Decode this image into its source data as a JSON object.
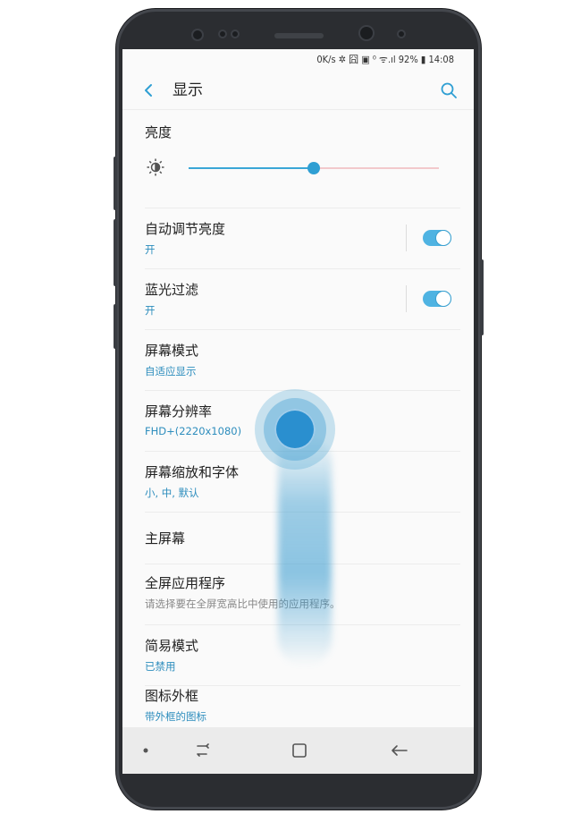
{
  "status_bar": {
    "text": "0K/s ✲ 囧 ▣ ⁰ ᯤ.ıl 92% ▮ 14:08"
  },
  "app_bar": {
    "title": "显示",
    "back_icon": "chevron-left-icon",
    "search_icon": "search-icon"
  },
  "brightness": {
    "title": "亮度",
    "icon": "sun-icon",
    "level": 0.5
  },
  "settings": [
    {
      "title": "自动调节亮度",
      "subtitle": "开",
      "toggle": true
    },
    {
      "title": "蓝光过滤",
      "subtitle": "开",
      "toggle": true
    },
    {
      "title": "屏幕模式",
      "subtitle": "自适应显示"
    },
    {
      "title": "屏幕分辨率",
      "subtitle": "FHD+(2220x1080)"
    },
    {
      "title": "屏幕缩放和字体",
      "subtitle": "小, 中, 默认"
    },
    {
      "title": "主屏幕",
      "subtitle": ""
    },
    {
      "title": "全屏应用程序",
      "subtitle": "请选择要在全屏宽高比中使用的应用程序。"
    },
    {
      "title": "简易模式",
      "subtitle": "已禁用"
    },
    {
      "title": "图标外框",
      "subtitle": "带外框的图标"
    }
  ],
  "colors": {
    "accent": "#2f9fd3",
    "toggle_on": "#4fb3e2",
    "subtitle": "#2d8dbd"
  },
  "nav_bar": {
    "items": [
      "dot-icon",
      "recents-icon",
      "home-icon",
      "back-icon"
    ]
  }
}
